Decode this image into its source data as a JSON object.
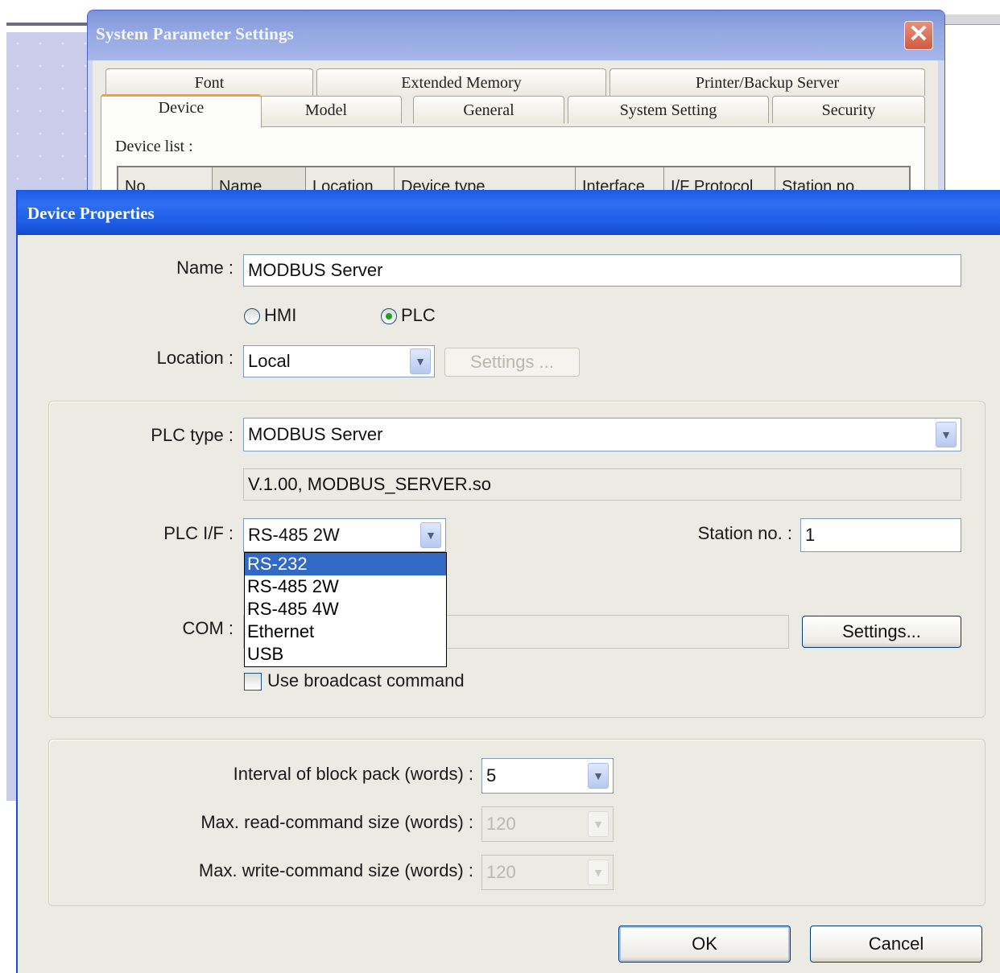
{
  "sps": {
    "title": "System Parameter Settings",
    "close_label": "✕",
    "tabs_row1": [
      "Font",
      "Extended Memory",
      "Printer/Backup Server"
    ],
    "tabs_row2": [
      "Device",
      "Model",
      "General",
      "System Setting",
      "Security"
    ],
    "active_tab": "Device",
    "device_list_label": "Device list :",
    "columns": [
      "No.",
      "Name",
      "Location",
      "Device type",
      "Interface",
      "I/F Protocol",
      "Station no."
    ]
  },
  "dp": {
    "title": "Device Properties",
    "name_label": "Name :",
    "name_value": "MODBUS Server",
    "type_options": {
      "hmi": "HMI",
      "plc": "PLC",
      "selected": "PLC"
    },
    "location_label": "Location :",
    "location_value": "Local",
    "location_settings_label": "Settings ...",
    "plc_type_label": "PLC type :",
    "plc_type_value": "MODBUS Server",
    "plc_version": "V.1.00, MODBUS_SERVER.so",
    "plc_if_label": "PLC I/F :",
    "plc_if_value": "RS-485 2W",
    "plc_if_options": [
      "RS-232",
      "RS-485 2W",
      "RS-485 4W",
      "Ethernet",
      "USB"
    ],
    "plc_if_highlighted": "RS-232",
    "station_label": "Station no. :",
    "station_value": "1",
    "com_label": "COM :",
    "com_settings_label": "Settings...",
    "broadcast_label": "Use broadcast command",
    "broadcast_checked": false,
    "interval_label": "Interval of block pack (words) :",
    "interval_value": "5",
    "max_read_label": "Max. read-command size (words) :",
    "max_read_value": "120",
    "max_write_label": "Max. write-command size (words) :",
    "max_write_value": "120",
    "ok_label": "OK",
    "cancel_label": "Cancel"
  },
  "icons": {
    "dropdown": "chevron-down-icon",
    "close": "close-icon",
    "radio": "radio-icon",
    "checkbox": "checkbox-icon"
  },
  "colors": {
    "titlebar_active": "#1f5fe8",
    "titlebar_inactive": "#94a7e2",
    "selection": "#316ac5",
    "dialog_bg": "#ecebe3"
  }
}
